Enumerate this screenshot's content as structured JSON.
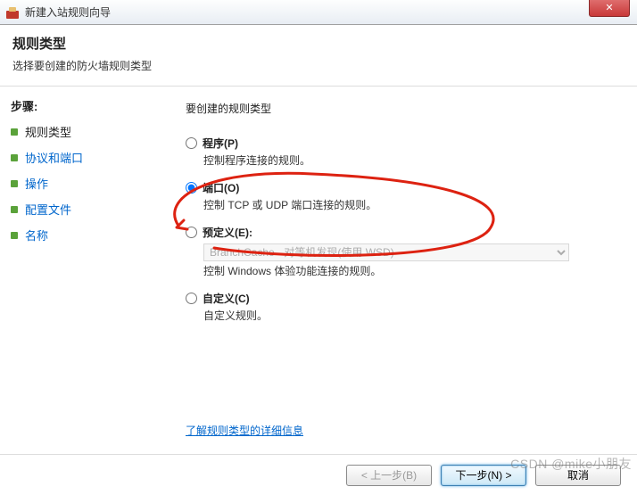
{
  "window": {
    "title": "新建入站规则向导",
    "close": "✕"
  },
  "header": {
    "title": "规则类型",
    "subtitle": "选择要创建的防火墙规则类型"
  },
  "sidebar": {
    "heading": "步骤:",
    "items": [
      {
        "label": "规则类型",
        "current": true
      },
      {
        "label": "协议和端口",
        "current": false
      },
      {
        "label": "操作",
        "current": false
      },
      {
        "label": "配置文件",
        "current": false
      },
      {
        "label": "名称",
        "current": false
      }
    ]
  },
  "main": {
    "prompt": "要创建的规则类型",
    "options": {
      "program": {
        "label": "程序(P)",
        "desc": "控制程序连接的规则。"
      },
      "port": {
        "label": "端口(O)",
        "desc": "控制 TCP 或 UDP 端口连接的规则。"
      },
      "predef": {
        "label": "预定义(E):",
        "desc": "控制 Windows 体验功能连接的规则。",
        "select": "BranchCache - 对等机发现(使用 WSD)"
      },
      "custom": {
        "label": "自定义(C)",
        "desc": "自定义规则。"
      }
    },
    "learn_more": "了解规则类型的详细信息"
  },
  "footer": {
    "back": "< 上一步(B)",
    "next": "下一步(N) >",
    "cancel": "取消"
  },
  "watermark": "CSDN @mike小朋友"
}
